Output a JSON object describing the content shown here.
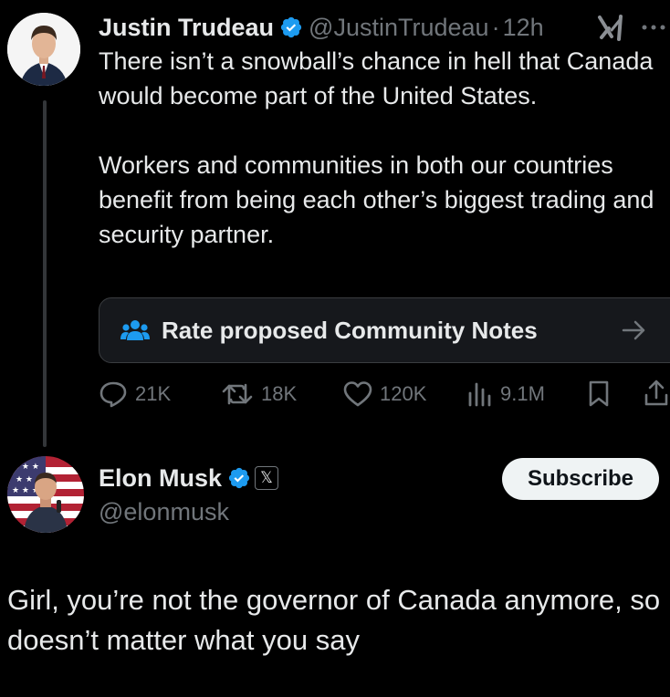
{
  "original_tweet": {
    "author_name": "Justin Trudeau",
    "handle": "@JustinTrudeau",
    "separator": "·",
    "time": "12h",
    "paragraphs": [
      "There isn’t a snowball’s chance in hell that Canada would become part of the United States.",
      "Workers and communities in both our countries benefit from being each other’s biggest trading and security partner."
    ],
    "community_notes_label": "Rate proposed Community Notes",
    "stats": {
      "replies": "21K",
      "reposts": "18K",
      "likes": "120K",
      "views": "9.1M"
    }
  },
  "reply": {
    "author_name": "Elon Musk",
    "handle": "@elonmusk",
    "affiliate_badge": "𝕏",
    "subscribe_label": "Subscribe",
    "text": "Girl, you’re not the governor of Canada anymore, so doesn’t matter what you say"
  },
  "colors": {
    "background": "#000000",
    "text_primary": "#e7e9ea",
    "text_muted": "#71767b",
    "verified_blue": "#1d9bf0",
    "notes_icon_blue": "#1d9bf0"
  },
  "icons": {
    "verified": "verified-badge-icon",
    "grok": "grok-icon",
    "more": "more-icon",
    "community_notes": "community-notes-icon",
    "arrow_right": "arrow-right-icon",
    "reply": "reply-icon",
    "repost": "repost-icon",
    "like": "heart-icon",
    "views": "views-icon",
    "bookmark": "bookmark-icon",
    "share": "share-icon"
  }
}
